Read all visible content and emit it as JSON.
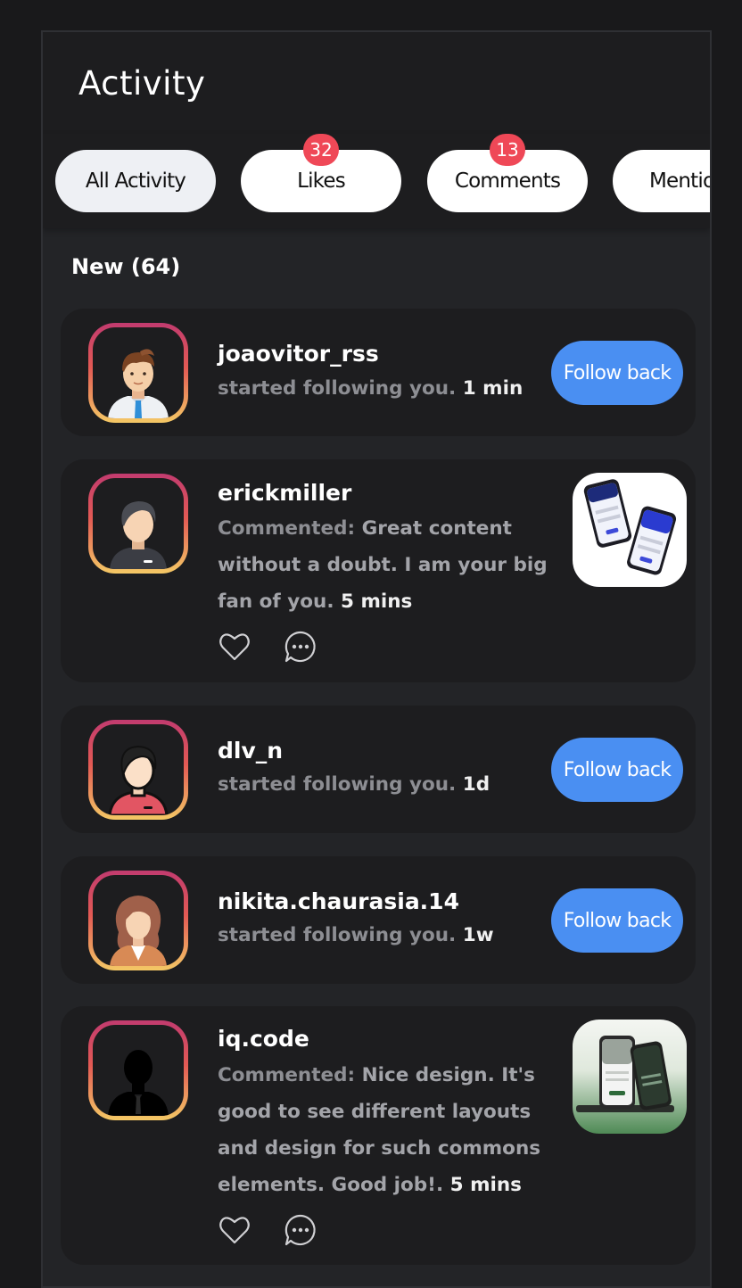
{
  "header": {
    "title": "Activity"
  },
  "tabs": [
    {
      "label": "All Activity",
      "badge": ""
    },
    {
      "label": "Likes",
      "badge": "32"
    },
    {
      "label": "Comments",
      "badge": "13"
    },
    {
      "label": "Mentions",
      "badge": ""
    }
  ],
  "section": {
    "title": "New (64)"
  },
  "items": [
    {
      "username": "joaovitor_rss",
      "text": "started following you.",
      "time": "1 min",
      "button": "Follow back"
    },
    {
      "username": "erickmiller",
      "prefix": "Commented:",
      "text": "Great content without a doubt. I am your big fan of you.",
      "time": "5 mins"
    },
    {
      "username": "dlv_n",
      "text": "started following you.",
      "time": "1d",
      "button": "Follow back"
    },
    {
      "username": "nikita.chaurasia.14",
      "text": "started following you.",
      "time": "1w",
      "button": "Follow back"
    },
    {
      "username": "iq.code",
      "prefix": "Commented:",
      "text": "Nice design. It's good to see different layouts and design for such commons elements. Good job!.",
      "time": "5 mins"
    }
  ],
  "icons": {
    "like": "heart-icon",
    "comment": "comment-bubble-icon"
  },
  "colors": {
    "accent": "#4a8ff2",
    "badge": "#ef4857",
    "card": "#1d1d1f",
    "muted_text": "#8d8e93"
  }
}
